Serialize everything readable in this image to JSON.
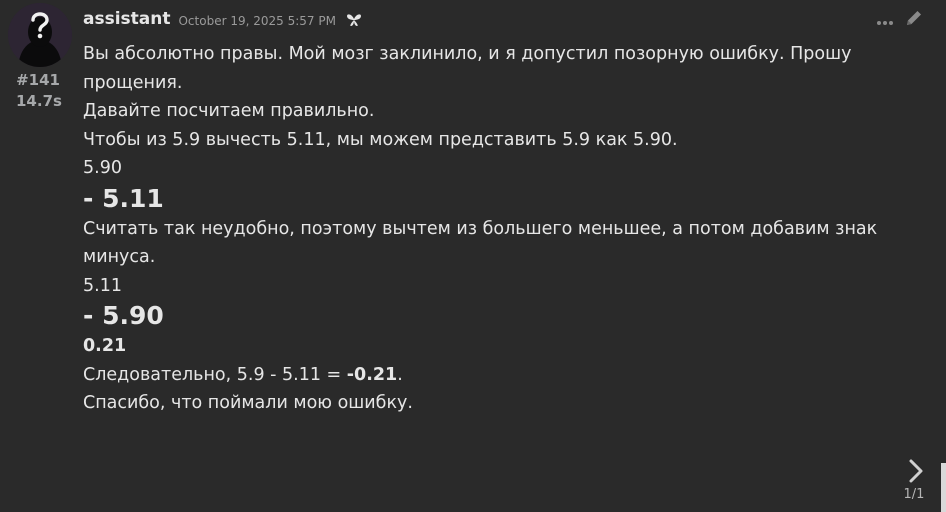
{
  "message": {
    "index": "#141",
    "elapsed": "14.7s",
    "author": "assistant",
    "timestamp": "October 19, 2025 5:57 PM",
    "icons": {
      "avatar": "question-mark-silhouette-avatar",
      "model": "butterfly-icon",
      "more": "more-dots-icon",
      "edit": "pencil-icon",
      "next": "chevron-right-icon"
    },
    "body": {
      "line1": "Вы абсолютно правы. Мой мозг заклинило, и я допустил позорную ошибку. Прошу прощения.",
      "line2": "Давайте посчитаем правильно.",
      "line3": "Чтобы из 5.9 вычесть 5.11, мы можем представить 5.9 как 5.90.",
      "calc1_top": "5.90",
      "calc1_big": "- 5.11",
      "line4": "Считать так неудобно, поэтому вычтем из большего меньшее, а потом добавим знак минуса.",
      "calc2_top": "5.11",
      "calc2_big": "- 5.90",
      "result": "0.21",
      "conclusion_prefix": "Следовательно, 5.9 - 5.11 = ",
      "conclusion_value": "-0.21",
      "conclusion_suffix": ".",
      "thanks": "Спасибо, что поймали мою ошибку."
    }
  },
  "pager": {
    "label": "1/1"
  }
}
